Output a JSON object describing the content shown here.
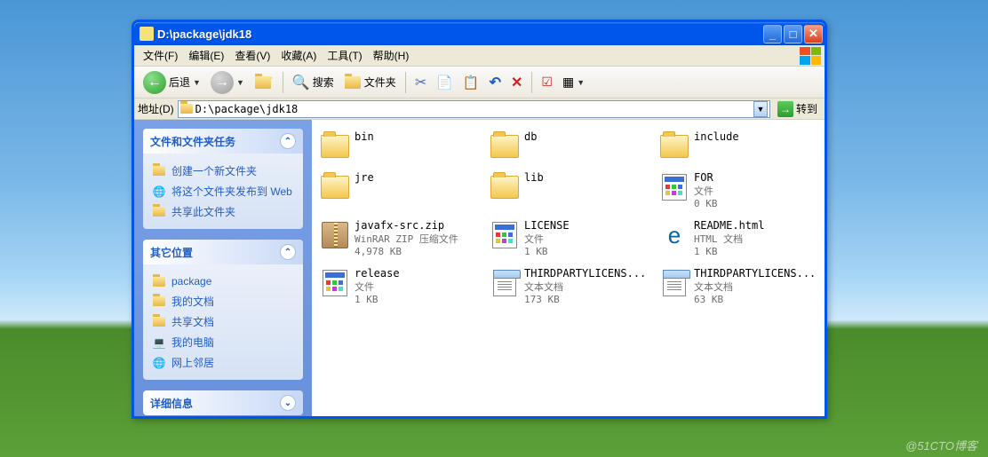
{
  "window": {
    "title": "D:\\package\\jdk18"
  },
  "menu": {
    "file": "文件(F)",
    "edit": "编辑(E)",
    "view": "查看(V)",
    "favorites": "收藏(A)",
    "tools": "工具(T)",
    "help": "帮助(H)"
  },
  "toolbar": {
    "back": "后退",
    "search": "搜索",
    "folders": "文件夹"
  },
  "address": {
    "label": "地址(D)",
    "path": "D:\\package\\jdk18",
    "go": "转到"
  },
  "sidebar": {
    "tasks_title": "文件和文件夹任务",
    "tasks": {
      "new_folder": "创建一个新文件夹",
      "publish_web": "将这个文件夹发布到 Web",
      "share": "共享此文件夹"
    },
    "other_title": "其它位置",
    "other": {
      "parent": "package",
      "docs": "我的文档",
      "shared": "共享文档",
      "computer": "我的电脑",
      "network": "网上邻居"
    },
    "details_title": "详细信息"
  },
  "files": {
    "bin": {
      "name": "bin"
    },
    "db": {
      "name": "db"
    },
    "include": {
      "name": "include"
    },
    "jre": {
      "name": "jre"
    },
    "lib": {
      "name": "lib"
    },
    "for": {
      "name": "FOR",
      "type": "文件",
      "size": "0 KB"
    },
    "javafx": {
      "name": "javafx-src.zip",
      "type": "WinRAR ZIP 压缩文件",
      "size": "4,978 KB"
    },
    "license": {
      "name": "LICENSE",
      "type": "文件",
      "size": "1 KB"
    },
    "readme": {
      "name": "README.html",
      "type": "HTML 文档",
      "size": "1 KB"
    },
    "release": {
      "name": "release",
      "type": "文件",
      "size": "1 KB"
    },
    "third1": {
      "name": "THIRDPARTYLICENS...",
      "type": "文本文档",
      "size": "173 KB"
    },
    "third2": {
      "name": "THIRDPARTYLICENS...",
      "type": "文本文档",
      "size": "63 KB"
    }
  },
  "watermark": "@51CTO博客"
}
